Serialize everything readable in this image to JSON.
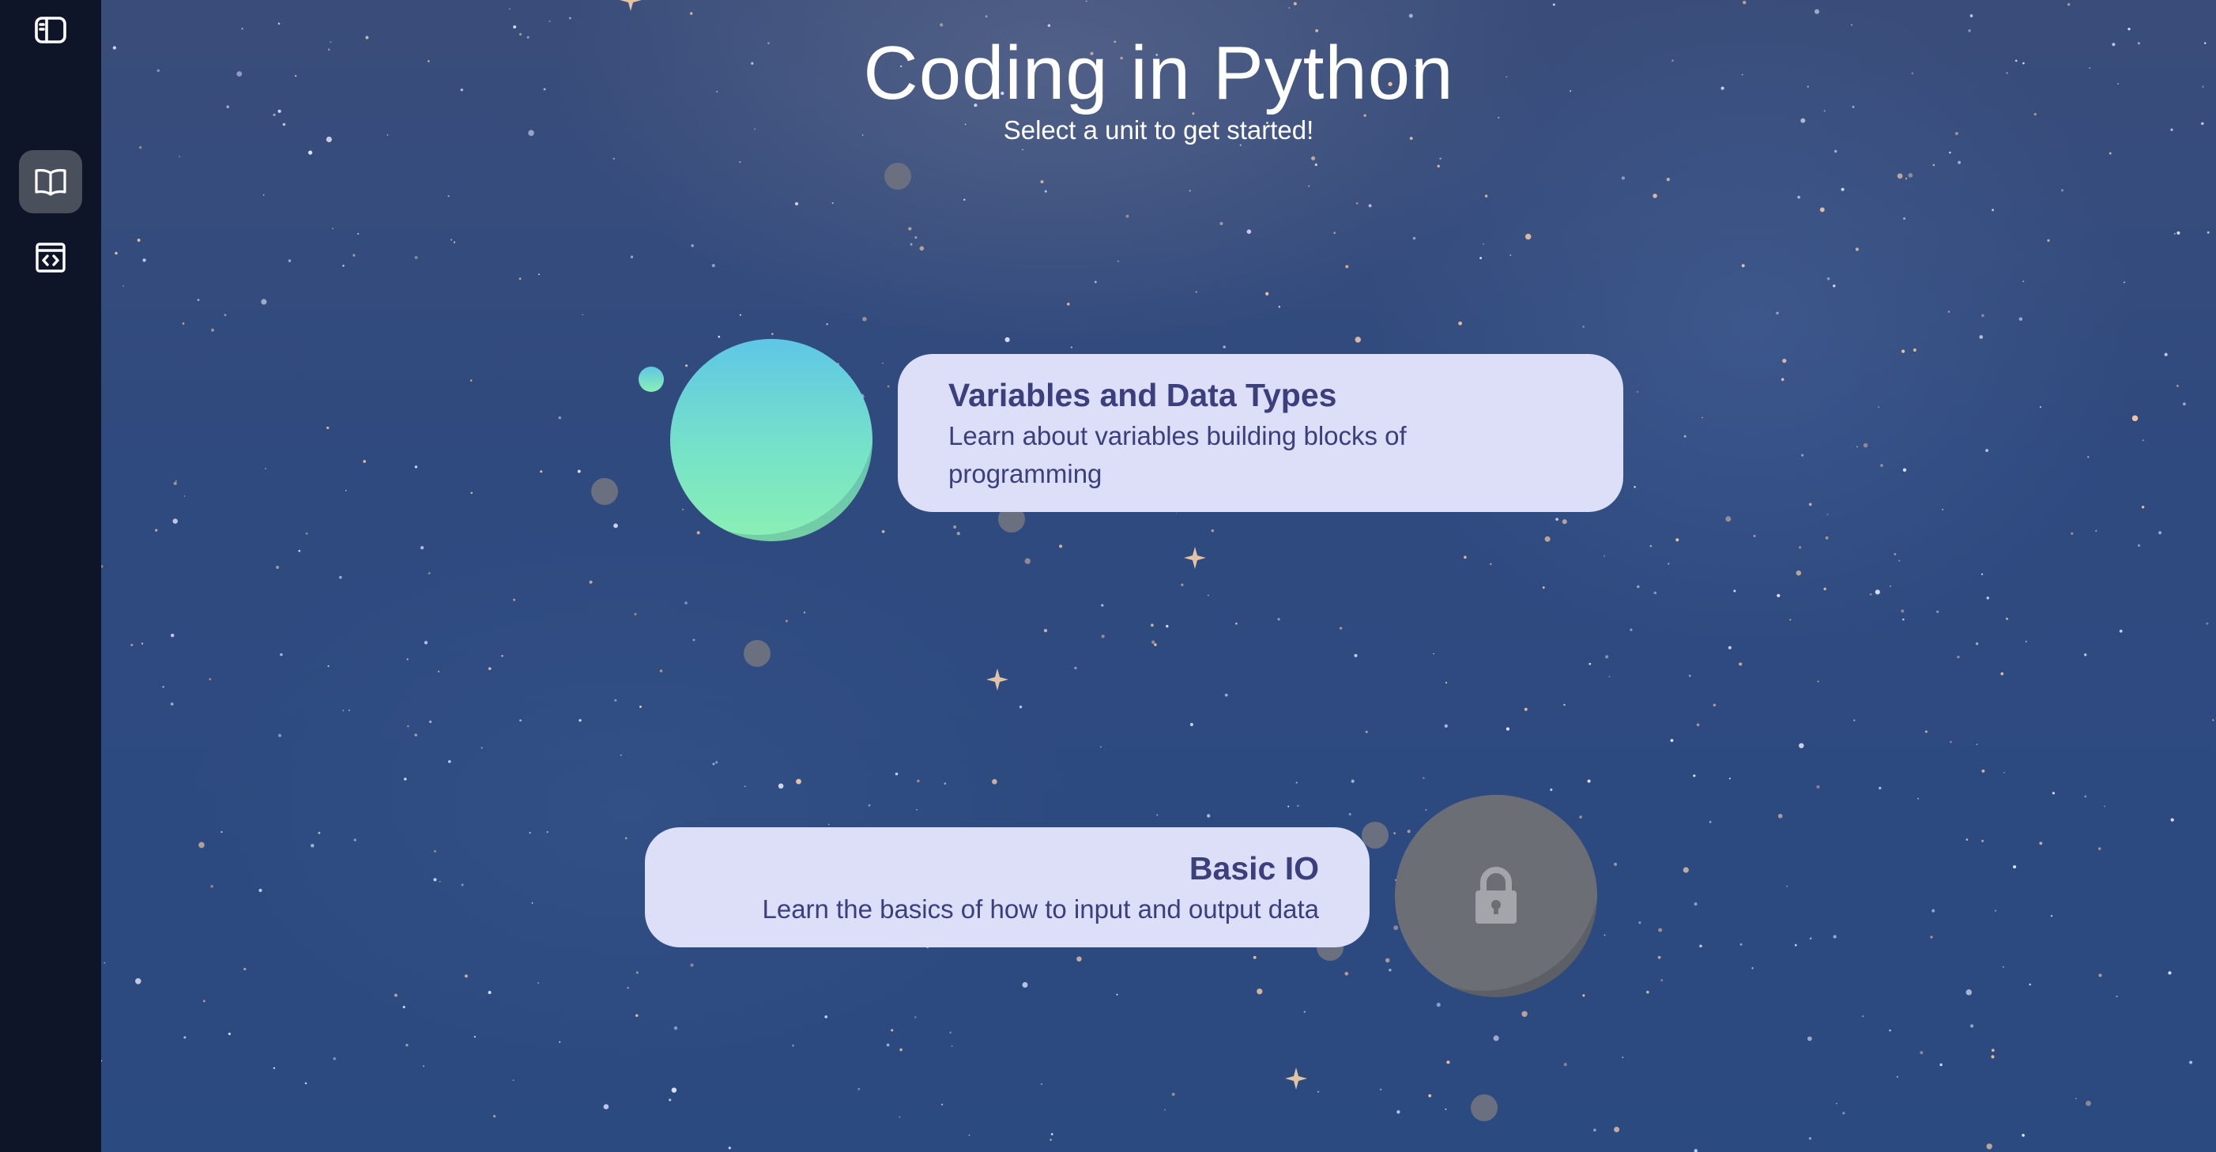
{
  "page": {
    "title": "Coding in Python",
    "subtitle": "Select a unit to get started!"
  },
  "sidebar": {
    "items": [
      {
        "icon": "sidebar-toggle-icon",
        "active": false
      },
      {
        "icon": "open-book-icon",
        "active": true
      },
      {
        "icon": "code-window-icon",
        "active": false
      }
    ]
  },
  "units": [
    {
      "title": "Variables and Data Types",
      "description": "Learn about variables building blocks of programming",
      "locked": false,
      "planet_color": "#76e2c8"
    },
    {
      "title": "Basic IO",
      "description": "Learn the basics of how to input and output data",
      "locked": true,
      "planet_color": "#6b6e75",
      "icon": "lock-icon"
    }
  ],
  "colors": {
    "sidebar": "#0f1529",
    "space": "#2f4a7f",
    "card": "#dcdff7",
    "card_text": "#3b3f7e",
    "active_nav": "#4a4f5c"
  }
}
